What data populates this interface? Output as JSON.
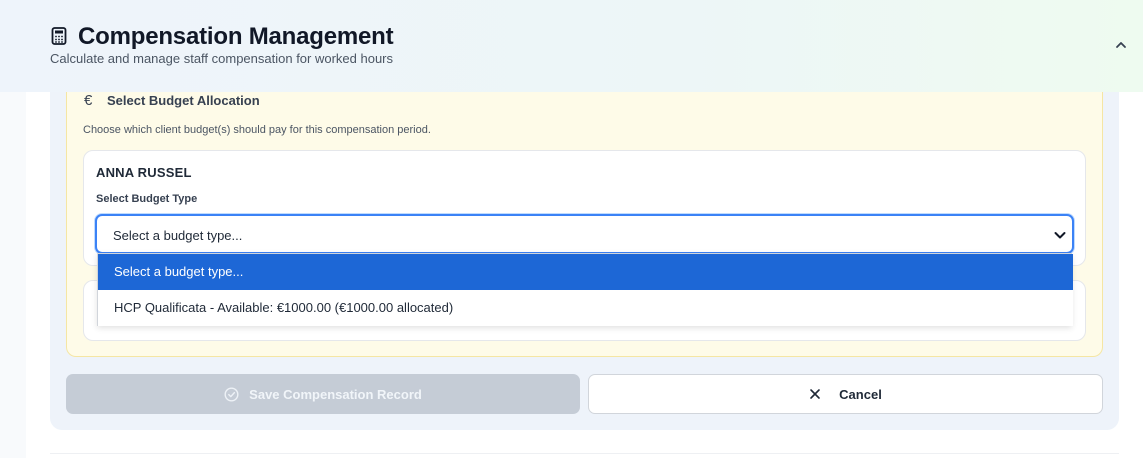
{
  "header": {
    "icon": "calculator-icon",
    "title": "Compensation Management",
    "subtitle": "Calculate and manage staff compensation for worked hours",
    "collapse_icon": "chevron-up-icon"
  },
  "budget_section": {
    "icon": "euro-icon",
    "icon_glyph": "€",
    "title": "Select Budget Allocation",
    "description": "Choose which client budget(s) should pay for this compensation period.",
    "client": {
      "name": "ANNA RUSSEL",
      "field_label": "Select Budget Type",
      "select_value": "Select a budget type...",
      "options": [
        "Select a budget type...",
        "HCP Qualificata - Available: €1000.00 (€1000.00 allocated)"
      ]
    }
  },
  "actions": {
    "save_label": "Save Compensation Record",
    "save_icon": "check-circle-icon",
    "cancel_label": "Cancel",
    "cancel_icon": "close-icon"
  },
  "colors": {
    "accent": "#1d67d6",
    "focus_border": "#3b82f6",
    "budget_panel_bg": "#fefbe8",
    "disabled_button": "#c5ccd6"
  }
}
